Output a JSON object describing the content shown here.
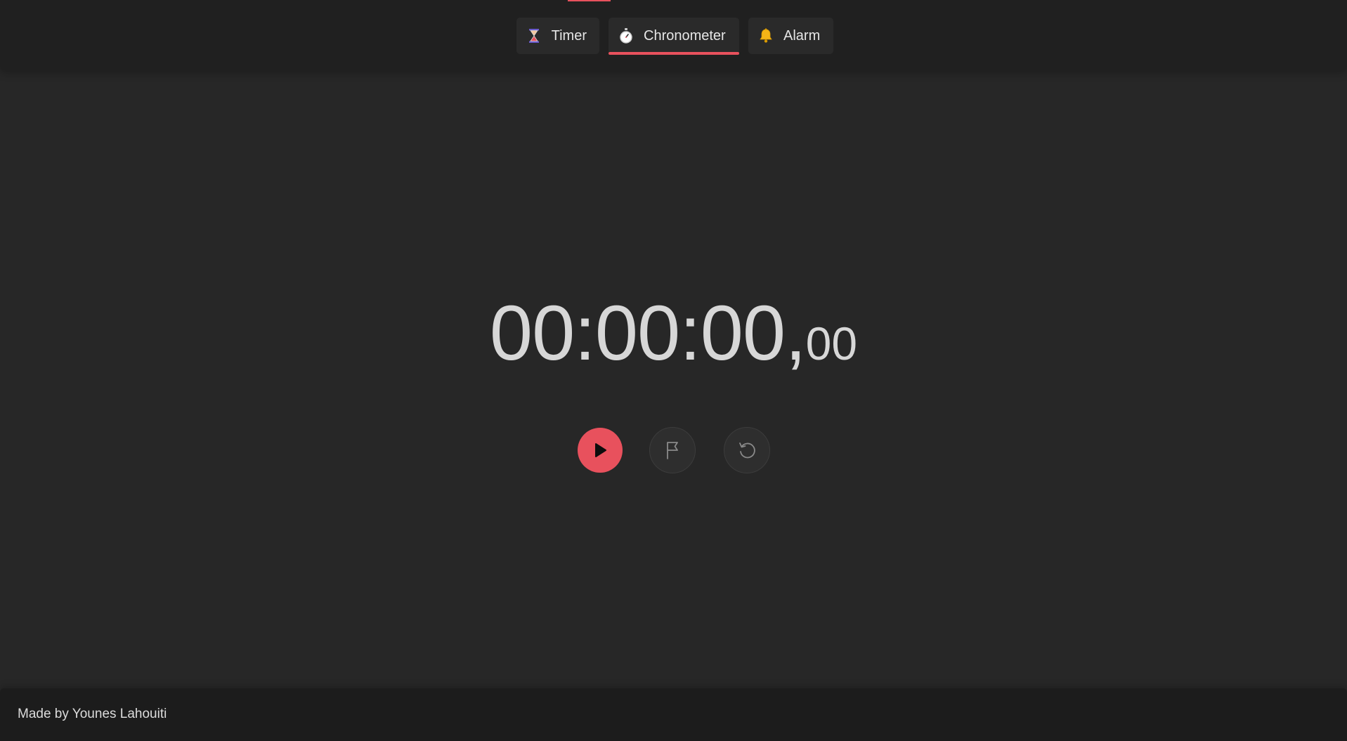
{
  "tabs": [
    {
      "label": "Timer",
      "icon": "hourglass-icon",
      "active": false
    },
    {
      "label": "Chronometer",
      "icon": "stopwatch-icon",
      "active": true
    },
    {
      "label": "Alarm",
      "icon": "bell-icon",
      "active": false
    }
  ],
  "clock": {
    "main": "00:00:00,",
    "fraction": "00"
  },
  "controls": {
    "play": "play-icon",
    "lap": "flag-icon",
    "reset": "reset-icon"
  },
  "footer": {
    "credit": "Made by Younes Lahouiti"
  },
  "colors": {
    "accent": "#e8515d",
    "background": "#272727",
    "topbar": "#202020",
    "footer": "#1c1c1c"
  }
}
